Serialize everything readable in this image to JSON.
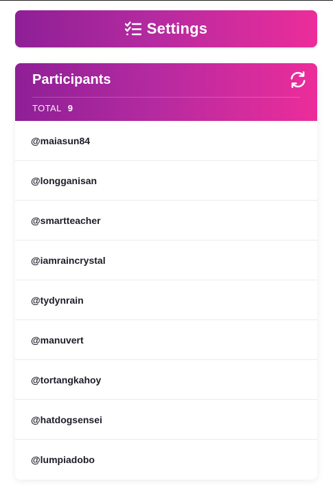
{
  "settings_button": {
    "label": "Settings",
    "icon": "checklist-icon"
  },
  "participants_panel": {
    "title": "Participants",
    "refresh_icon": "refresh-icon",
    "total_label": "TOTAL",
    "total_count": "9",
    "items": [
      {
        "handle": "@maiasun84"
      },
      {
        "handle": "@longganisan"
      },
      {
        "handle": "@smartteacher"
      },
      {
        "handle": "@iamraincrystal"
      },
      {
        "handle": "@tydynrain"
      },
      {
        "handle": "@manuvert"
      },
      {
        "handle": "@tortangkahoy"
      },
      {
        "handle": "@hatdogsensei"
      },
      {
        "handle": "@lumpiadobo"
      }
    ]
  },
  "colors": {
    "gradient_start": "#8e1f96",
    "gradient_end": "#ec2d9a",
    "text_dark": "#1c1c28",
    "divider": "#ebebeb"
  }
}
